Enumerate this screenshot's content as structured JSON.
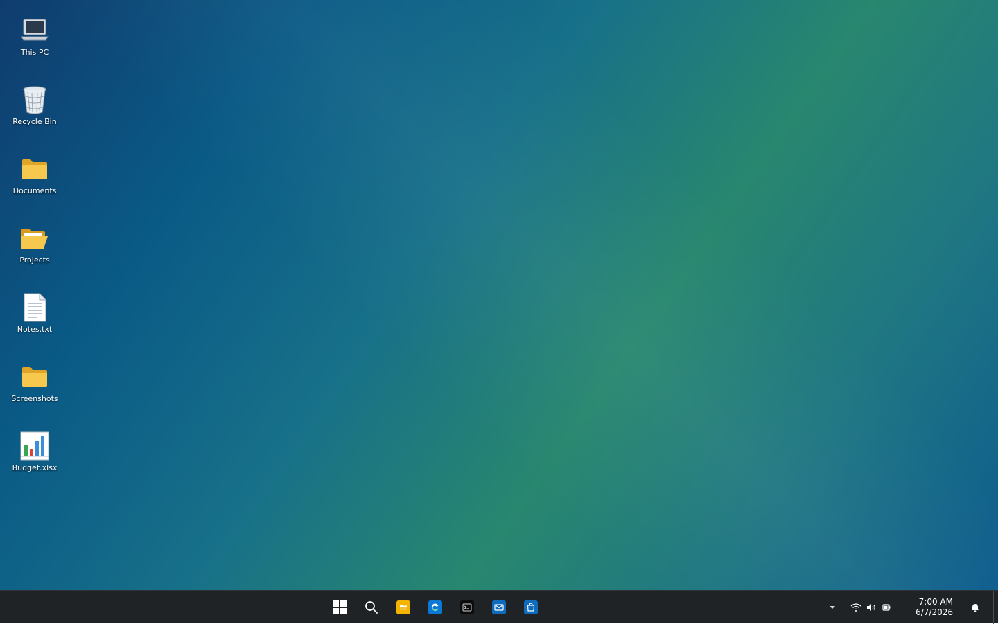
{
  "desktop_icons": [
    {
      "label": "This PC",
      "icon": "computer-icon"
    },
    {
      "label": "Recycle Bin",
      "icon": "recycle-bin-icon"
    },
    {
      "label": "Documents",
      "icon": "folder-icon"
    },
    {
      "label": "Projects",
      "icon": "open-folder-icon"
    },
    {
      "label": "Notes.txt",
      "icon": "text-file-icon"
    },
    {
      "label": "Screenshots",
      "icon": "folder-icon"
    },
    {
      "label": "Budget.xlsx",
      "icon": "spreadsheet-icon"
    }
  ],
  "taskbar": {
    "pinned": [
      {
        "name": "start",
        "icon": "windows-logo-icon"
      },
      {
        "name": "search",
        "icon": "search-icon"
      },
      {
        "name": "file-explorer",
        "icon": "file-explorer-icon",
        "color": "#f4b400"
      },
      {
        "name": "edge",
        "icon": "edge-browser-icon",
        "color": "#0a78d4"
      },
      {
        "name": "terminal",
        "icon": "terminal-icon",
        "color": "#0c0c0c"
      },
      {
        "name": "mail",
        "icon": "mail-icon",
        "color": "#0f6cbd"
      },
      {
        "name": "store",
        "icon": "store-icon",
        "color": "#0f6cbd"
      }
    ],
    "tray": {
      "icons": [
        "chevron-up-icon",
        "wifi-icon",
        "volume-icon",
        "battery-icon"
      ],
      "time": "7:00 AM",
      "date": "6/7/2026",
      "notification_icon": "bell-icon"
    }
  },
  "colors": {
    "taskbar_bg": "#1f2326",
    "wallpaper_dark": "#0f3c6e",
    "wallpaper_green": "#28876f"
  }
}
